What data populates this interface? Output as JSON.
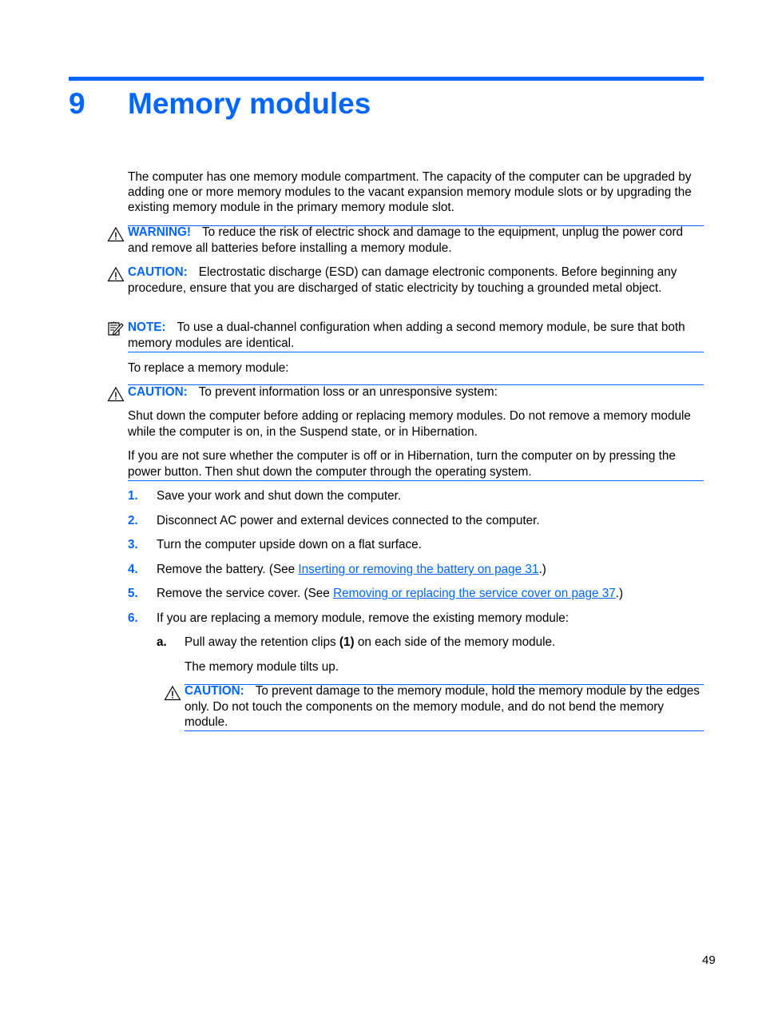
{
  "chapter": {
    "number": "9",
    "title": "Memory modules"
  },
  "intro": "The computer has one memory module compartment. The capacity of the computer can be upgraded by adding one or more memory modules to the vacant expansion memory module slots or by upgrading the existing memory module in the primary memory module slot.",
  "notices": {
    "warning": {
      "icon": "warning-triangle-icon",
      "label": "WARNING!",
      "text": "To reduce the risk of electric shock and damage to the equipment, unplug the power cord and remove all batteries before installing a memory module."
    },
    "caution_esd": {
      "icon": "warning-triangle-icon",
      "label": "CAUTION:",
      "text": "Electrostatic discharge (ESD) can damage electronic components. Before beginning any procedure, ensure that you are discharged of static electricity by touching a grounded metal object."
    },
    "note": {
      "icon": "note-pencil-icon",
      "label": "NOTE:",
      "text": "To use a dual-channel configuration when adding a second memory module, be sure that both memory modules are identical."
    },
    "caution_loss": {
      "icon": "warning-triangle-icon",
      "label": "CAUTION:",
      "text": "To prevent information loss or an unresponsive system:",
      "para1": "Shut down the computer before adding or replacing memory modules. Do not remove a memory module while the computer is on, in the Suspend state, or in Hibernation.",
      "para2": "If you are not sure whether the computer is off or in Hibernation, turn the computer on by pressing the power button. Then shut down the computer through the operating system."
    },
    "caution_damage": {
      "icon": "warning-triangle-icon",
      "label": "CAUTION:",
      "text": "To prevent damage to the memory module, hold the memory module by the edges only. Do not touch the components on the memory module, and do not bend the memory module."
    }
  },
  "replace_intro": "To replace a memory module:",
  "steps": [
    {
      "num": "1.",
      "text": "Save your work and shut down the computer."
    },
    {
      "num": "2.",
      "text": "Disconnect AC power and external devices connected to the computer."
    },
    {
      "num": "3.",
      "text": "Turn the computer upside down on a flat surface."
    },
    {
      "num": "4.",
      "pre": "Remove the battery. (See ",
      "link": "Inserting or removing the battery on page 31",
      "post": ".)"
    },
    {
      "num": "5.",
      "pre": "Remove the service cover. (See ",
      "link": "Removing or replacing the service cover on page 37",
      "post": ".)"
    },
    {
      "num": "6.",
      "text": "If you are replacing a memory module, remove the existing memory module:"
    }
  ],
  "substeps": [
    {
      "num": "a.",
      "pre": "Pull away the retention clips ",
      "bold": "(1)",
      "post": " on each side of the memory module.",
      "result": "The memory module tilts up."
    }
  ],
  "page_number": "49",
  "colors": {
    "accent": "#0066ff"
  }
}
